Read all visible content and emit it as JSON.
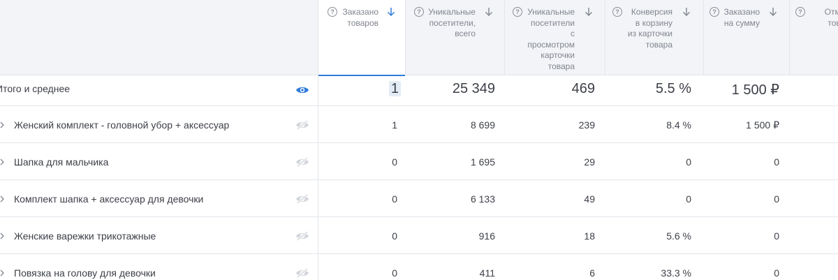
{
  "columns": [
    {
      "id": "ordered",
      "title": [
        "Заказано",
        "товаров"
      ],
      "sorted": true
    },
    {
      "id": "visitors",
      "title": [
        "Уникальные",
        "посетители,",
        "всего"
      ],
      "sorted": false
    },
    {
      "id": "card_visitors",
      "title": [
        "Уникальные",
        "посетители",
        "с",
        "просмотром",
        "карточки",
        "товара"
      ],
      "sorted": false
    },
    {
      "id": "conversion",
      "title": [
        "Конверсия",
        "в корзину",
        "из карточки",
        "товара"
      ],
      "sorted": false
    },
    {
      "id": "ordered_sum",
      "title": [
        "Заказано",
        "на сумму"
      ],
      "sorted": false
    },
    {
      "id": "cancelled",
      "title": [
        "Отмен",
        "товар"
      ],
      "sorted": false
    }
  ],
  "total": {
    "label": "Итого и среднее",
    "values": [
      "1",
      "25 349",
      "469",
      "5.5 %",
      "1 500 ₽"
    ]
  },
  "rows": [
    {
      "label": "Женский комплект - головной убор + аксессуар",
      "values": [
        "1",
        "8 699",
        "239",
        "8.4 %",
        "1 500 ₽"
      ]
    },
    {
      "label": "Шапка для мальчика",
      "values": [
        "0",
        "1 695",
        "29",
        "0",
        "0"
      ]
    },
    {
      "label": "Комплект шапка + аксессуар для девочки",
      "values": [
        "0",
        "6 133",
        "49",
        "0",
        "0"
      ]
    },
    {
      "label": "Женские варежки трикотажные",
      "values": [
        "0",
        "916",
        "18",
        "5.6 %",
        "0"
      ]
    },
    {
      "label": "Повязка на голову для девочки",
      "values": [
        "0",
        "411",
        "6",
        "33.3 %",
        "0"
      ]
    }
  ],
  "colors": {
    "accent": "#2f7bdb",
    "header_bg": "#f3f4f7",
    "eye_off": "#c8cbd1"
  },
  "icons": {
    "help": "question-circle-icon",
    "sort": "arrow-down-icon",
    "visible": "eye-icon",
    "hidden": "eye-off-icon",
    "expand": "chevron-right-icon"
  }
}
